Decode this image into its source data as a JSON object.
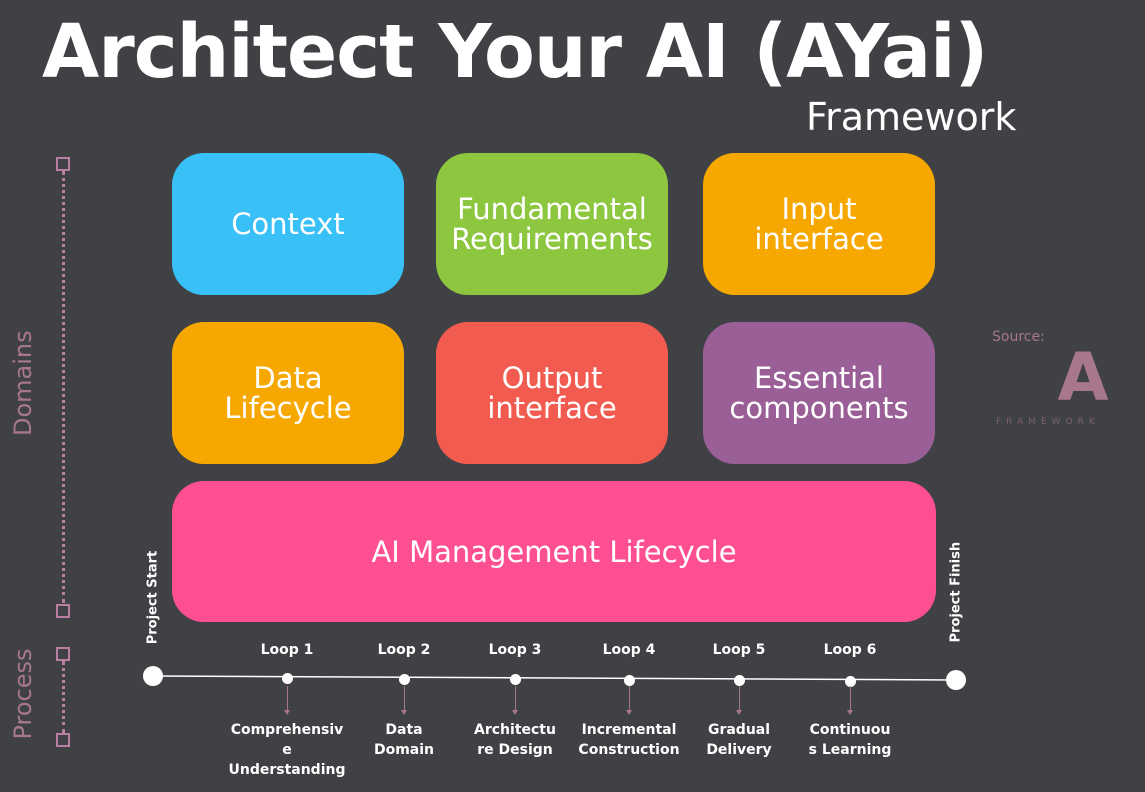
{
  "title": "Architect Your AI (AYai)",
  "subtitle": "Framework",
  "domains": [
    {
      "label_lines": [
        "Context"
      ],
      "color": "#38c0f7"
    },
    {
      "label_lines": [
        "Fundamental",
        "Requirements"
      ],
      "color": "#8dc63f"
    },
    {
      "label_lines": [
        "Input",
        "interface"
      ],
      "color": "#f7a800"
    },
    {
      "label_lines": [
        "Data",
        "Lifecycle"
      ],
      "color": "#f7a800"
    },
    {
      "label_lines": [
        "Output",
        "interface"
      ],
      "color": "#f15b50"
    },
    {
      "label_lines": [
        "Essential",
        "components"
      ],
      "color": "#9b5f97"
    }
  ],
  "management": {
    "label": "AI Management Lifecycle",
    "color": "#ff4f93"
  },
  "axis": {
    "domains_label": "Domains",
    "process_label": "Process"
  },
  "project": {
    "start": "Project Start",
    "finish": "Project Finish"
  },
  "loops": [
    {
      "label": "Loop 1",
      "stage_lines": [
        "Comprehensiv",
        "e",
        "Understanding"
      ]
    },
    {
      "label": "Loop 2",
      "stage_lines": [
        "Data",
        "Domain"
      ]
    },
    {
      "label": "Loop 3",
      "stage_lines": [
        "Architectu",
        "re Design"
      ]
    },
    {
      "label": "Loop 4",
      "stage_lines": [
        "Incremental",
        "Construction"
      ]
    },
    {
      "label": "Loop 5",
      "stage_lines": [
        "Gradual",
        "Delivery"
      ]
    },
    {
      "label": "Loop 6",
      "stage_lines": [
        "Continuou",
        "s Learning"
      ]
    }
  ],
  "source": {
    "label": "Source:",
    "logo_letter": "A",
    "logo_text": "FRAMEWORK"
  }
}
